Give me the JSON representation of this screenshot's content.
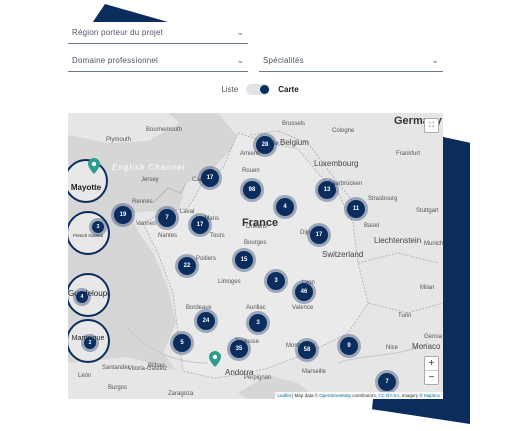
{
  "filters": {
    "region": "Région porteur du projet",
    "domaine": "Domaine professionnel",
    "specialites": "Spécialités"
  },
  "view_toggle": {
    "list_label": "Liste",
    "map_label": "Carte",
    "active": "Carte"
  },
  "map": {
    "labels": [
      {
        "text": "Germany",
        "cls": "big"
      },
      {
        "text": "France",
        "cls": "big"
      },
      {
        "text": "Belgium",
        "cls": "mid"
      },
      {
        "text": "Luxembourg",
        "cls": "mid"
      },
      {
        "text": "Switzerland",
        "cls": "mid"
      },
      {
        "text": "Liechtenstein",
        "cls": "mid"
      },
      {
        "text": "Monaco",
        "cls": "mid"
      },
      {
        "text": "Andorra",
        "cls": "mid"
      },
      {
        "text": "English Channel",
        "cls": "sea"
      },
      {
        "text": "Brussels"
      },
      {
        "text": "Cologne"
      },
      {
        "text": "Plymouth"
      },
      {
        "text": "Bournemouth"
      },
      {
        "text": "Rouen"
      },
      {
        "text": "Amiens"
      },
      {
        "text": "Caen"
      },
      {
        "text": "Jersey"
      },
      {
        "text": "Rennes"
      },
      {
        "text": "Vannes"
      },
      {
        "text": "Nantes"
      },
      {
        "text": "Tours"
      },
      {
        "text": "Orléans"
      },
      {
        "text": "Poitiers"
      },
      {
        "text": "Limoges"
      },
      {
        "text": "Bourges"
      },
      {
        "text": "Dijon"
      },
      {
        "text": "Strasbourg"
      },
      {
        "text": "Basel"
      },
      {
        "text": "Lyon"
      },
      {
        "text": "Valence"
      },
      {
        "text": "Bordeaux"
      },
      {
        "text": "Aurillac"
      },
      {
        "text": "Toulouse"
      },
      {
        "text": "Marseille"
      },
      {
        "text": "Montpellier"
      },
      {
        "text": "Perpignan"
      },
      {
        "text": "Nice"
      },
      {
        "text": "Turin"
      },
      {
        "text": "Milan"
      },
      {
        "text": "Genoa"
      },
      {
        "text": "Frankfurt"
      },
      {
        "text": "Stuttgart"
      },
      {
        "text": "Munich"
      },
      {
        "text": "Saarbrücken"
      },
      {
        "text": "Lille"
      },
      {
        "text": "Laval"
      },
      {
        "text": "Le Mans"
      },
      {
        "text": "Santander"
      },
      {
        "text": "Bilbao"
      },
      {
        "text": "Vitoria-Gasteiz"
      },
      {
        "text": "León"
      },
      {
        "text": "Zaragoza"
      },
      {
        "text": "Burgos"
      }
    ],
    "clusters": [
      "28",
      "17",
      "98",
      "13",
      "4",
      "11",
      "19",
      "7",
      "17",
      "17",
      "22",
      "15",
      "3",
      "46",
      "24",
      "3",
      "35",
      "58",
      "9",
      "5",
      "7"
    ],
    "insets": [
      {
        "name": "Mayotte"
      },
      {
        "name": "French Guiana",
        "count": "3"
      },
      {
        "name": "Guadeloupe",
        "count": "4"
      },
      {
        "name": "Martinique",
        "count": "2"
      }
    ],
    "controls": {
      "zoom_in": "+",
      "zoom_out": "−",
      "fullscreen": "⛶"
    },
    "attribution": {
      "leaflet": "Leaflet",
      "sep1": " | Map data © ",
      "osm": "OpenStreetMap",
      "sep2": " contributors, ",
      "license": "CC-BY-SA",
      "sep3": ", Imagery © ",
      "mapbox": "Mapbox"
    }
  },
  "colors": {
    "navy": "#0b2d5e",
    "teal": "#2a9d8f",
    "map_bg": "#d9d9d9",
    "land": "#e4e4e4"
  }
}
